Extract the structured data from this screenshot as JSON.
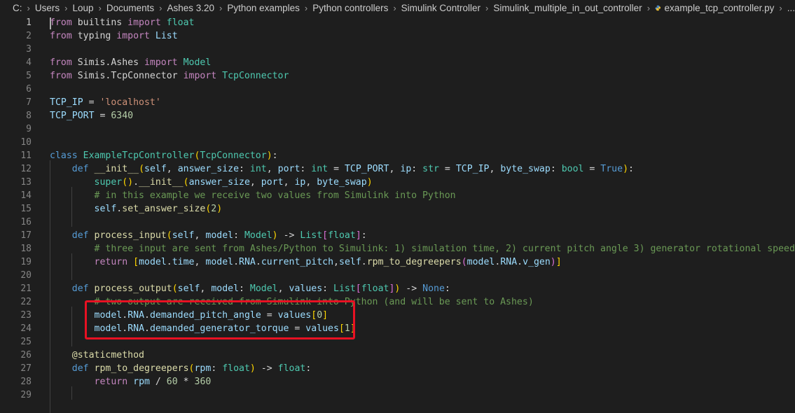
{
  "breadcrumb": {
    "items": [
      "C:",
      "Users",
      "Loup",
      "Documents",
      "Ashes 3.20",
      "Python examples",
      "Python controllers",
      "Simulink Controller",
      "Simulink_multiple_in_out_controller"
    ],
    "file_icon": "python-file-icon",
    "file": "example_tcp_controller.py",
    "more": "..."
  },
  "editor": {
    "active_line": 1,
    "highlight": {
      "label": "red-annotation-box",
      "lines": [
        23,
        24
      ],
      "color": "#e81123"
    },
    "lines": [
      {
        "n": "1",
        "t": [
          [
            "from",
            "kw"
          ],
          [
            " builtins ",
            "tx"
          ],
          [
            "import",
            "kw"
          ],
          [
            " float",
            "cls"
          ]
        ]
      },
      {
        "n": "2",
        "t": [
          [
            "from",
            "kw"
          ],
          [
            " typing ",
            "tx"
          ],
          [
            "import",
            "kw"
          ],
          [
            " List",
            "var"
          ]
        ]
      },
      {
        "n": "3",
        "t": []
      },
      {
        "n": "4",
        "t": [
          [
            "from",
            "kw"
          ],
          [
            " Simis.Ashes ",
            "tx"
          ],
          [
            "import",
            "kw"
          ],
          [
            " Model",
            "cls"
          ]
        ]
      },
      {
        "n": "5",
        "t": [
          [
            "from",
            "kw"
          ],
          [
            " Simis.TcpConnector ",
            "tx"
          ],
          [
            "import",
            "kw"
          ],
          [
            " TcpConnector",
            "cls"
          ]
        ]
      },
      {
        "n": "6",
        "t": []
      },
      {
        "n": "7",
        "t": [
          [
            "TCP_IP",
            "var"
          ],
          [
            " = ",
            "tx"
          ],
          [
            "'localhost'",
            "str"
          ]
        ]
      },
      {
        "n": "8",
        "t": [
          [
            "TCP_PORT",
            "var"
          ],
          [
            " = ",
            "tx"
          ],
          [
            "6340",
            "num"
          ]
        ]
      },
      {
        "n": "9",
        "t": []
      },
      {
        "n": "10",
        "t": []
      },
      {
        "n": "11",
        "t": [
          [
            "class",
            "st"
          ],
          [
            " ",
            "tx"
          ],
          [
            "ExampleTcpController",
            "cls"
          ],
          [
            "(",
            "br1"
          ],
          [
            "TcpConnector",
            "cls"
          ],
          [
            ")",
            "br1"
          ],
          [
            ":",
            "tx"
          ]
        ]
      },
      {
        "n": "12",
        "t": [
          [
            "    ",
            "tx"
          ],
          [
            "def",
            "st"
          ],
          [
            " ",
            "tx"
          ],
          [
            "__init__",
            "fn"
          ],
          [
            "(",
            "br1"
          ],
          [
            "self",
            "var"
          ],
          [
            ", ",
            "tx"
          ],
          [
            "answer_size",
            "var"
          ],
          [
            ": ",
            "tx"
          ],
          [
            "int",
            "cls"
          ],
          [
            ", ",
            "tx"
          ],
          [
            "port",
            "var"
          ],
          [
            ": ",
            "tx"
          ],
          [
            "int",
            "cls"
          ],
          [
            " = ",
            "tx"
          ],
          [
            "TCP_PORT",
            "var"
          ],
          [
            ", ",
            "tx"
          ],
          [
            "ip",
            "var"
          ],
          [
            ": ",
            "tx"
          ],
          [
            "str",
            "cls"
          ],
          [
            " = ",
            "tx"
          ],
          [
            "TCP_IP",
            "var"
          ],
          [
            ", ",
            "tx"
          ],
          [
            "byte_swap",
            "var"
          ],
          [
            ": ",
            "tx"
          ],
          [
            "bool",
            "cls"
          ],
          [
            " = ",
            "tx"
          ],
          [
            "True",
            "st"
          ],
          [
            ")",
            "br1"
          ],
          [
            ":",
            "tx"
          ]
        ]
      },
      {
        "n": "13",
        "t": [
          [
            "        ",
            "tx"
          ],
          [
            "super",
            "cls"
          ],
          [
            "()",
            "br1"
          ],
          [
            ".",
            "tx"
          ],
          [
            "__init__",
            "fn"
          ],
          [
            "(",
            "br1"
          ],
          [
            "answer_size",
            "var"
          ],
          [
            ", ",
            "tx"
          ],
          [
            "port",
            "var"
          ],
          [
            ", ",
            "tx"
          ],
          [
            "ip",
            "var"
          ],
          [
            ", ",
            "tx"
          ],
          [
            "byte_swap",
            "var"
          ],
          [
            ")",
            "br1"
          ]
        ]
      },
      {
        "n": "14",
        "t": [
          [
            "        ",
            "tx"
          ],
          [
            "# in this example we receive two values from Simulink into Python",
            "com"
          ]
        ]
      },
      {
        "n": "15",
        "t": [
          [
            "        ",
            "tx"
          ],
          [
            "self",
            "var"
          ],
          [
            ".",
            "tx"
          ],
          [
            "set_answer_size",
            "fn"
          ],
          [
            "(",
            "br1"
          ],
          [
            "2",
            "num"
          ],
          [
            ")",
            "br1"
          ]
        ]
      },
      {
        "n": "16",
        "t": []
      },
      {
        "n": "17",
        "t": [
          [
            "    ",
            "tx"
          ],
          [
            "def",
            "st"
          ],
          [
            " ",
            "tx"
          ],
          [
            "process_input",
            "fn"
          ],
          [
            "(",
            "br1"
          ],
          [
            "self",
            "var"
          ],
          [
            ", ",
            "tx"
          ],
          [
            "model",
            "var"
          ],
          [
            ": ",
            "tx"
          ],
          [
            "Model",
            "cls"
          ],
          [
            ")",
            "br1"
          ],
          [
            " -> ",
            "tx"
          ],
          [
            "List",
            "cls"
          ],
          [
            "[",
            "br2"
          ],
          [
            "float",
            "cls"
          ],
          [
            "]",
            "br2"
          ],
          [
            ":",
            "tx"
          ]
        ]
      },
      {
        "n": "18",
        "t": [
          [
            "        ",
            "tx"
          ],
          [
            "# three input are sent from Ashes/Python to Simulink: 1) simulation time, 2) current pitch angle 3) generator rotational speed",
            "com"
          ]
        ]
      },
      {
        "n": "19",
        "t": [
          [
            "        ",
            "tx"
          ],
          [
            "return",
            "kw"
          ],
          [
            " ",
            "tx"
          ],
          [
            "[",
            "br1"
          ],
          [
            "model",
            "var"
          ],
          [
            ".",
            "tx"
          ],
          [
            "time",
            "var"
          ],
          [
            ", ",
            "tx"
          ],
          [
            "model",
            "var"
          ],
          [
            ".",
            "tx"
          ],
          [
            "RNA",
            "var"
          ],
          [
            ".",
            "tx"
          ],
          [
            "current_pitch",
            "var"
          ],
          [
            ",",
            "tx"
          ],
          [
            "self",
            "var"
          ],
          [
            ".",
            "tx"
          ],
          [
            "rpm_to_degreepers",
            "fn"
          ],
          [
            "(",
            "br2"
          ],
          [
            "model",
            "var"
          ],
          [
            ".",
            "tx"
          ],
          [
            "RNA",
            "var"
          ],
          [
            ".",
            "tx"
          ],
          [
            "v_gen",
            "var"
          ],
          [
            ")",
            "br2"
          ],
          [
            "]",
            "br1"
          ]
        ]
      },
      {
        "n": "20",
        "t": []
      },
      {
        "n": "21",
        "t": [
          [
            "    ",
            "tx"
          ],
          [
            "def",
            "st"
          ],
          [
            " ",
            "tx"
          ],
          [
            "process_output",
            "fn"
          ],
          [
            "(",
            "br1"
          ],
          [
            "self",
            "var"
          ],
          [
            ", ",
            "tx"
          ],
          [
            "model",
            "var"
          ],
          [
            ": ",
            "tx"
          ],
          [
            "Model",
            "cls"
          ],
          [
            ", ",
            "tx"
          ],
          [
            "values",
            "var"
          ],
          [
            ": ",
            "tx"
          ],
          [
            "List",
            "cls"
          ],
          [
            "[",
            "br2"
          ],
          [
            "float",
            "cls"
          ],
          [
            "]",
            "br2"
          ],
          [
            ")",
            "br1"
          ],
          [
            " -> ",
            "tx"
          ],
          [
            "None",
            "st"
          ],
          [
            ":",
            "tx"
          ]
        ]
      },
      {
        "n": "22",
        "t": [
          [
            "        ",
            "tx"
          ],
          [
            "# two output are received from Simulink into Python (and will be sent to Ashes)",
            "com"
          ]
        ]
      },
      {
        "n": "23",
        "t": [
          [
            "        ",
            "tx"
          ],
          [
            "model",
            "var"
          ],
          [
            ".",
            "tx"
          ],
          [
            "RNA",
            "var"
          ],
          [
            ".",
            "tx"
          ],
          [
            "demanded_pitch_angle",
            "var"
          ],
          [
            " = ",
            "tx"
          ],
          [
            "values",
            "var"
          ],
          [
            "[",
            "br1"
          ],
          [
            "0",
            "num"
          ],
          [
            "]",
            "br1"
          ]
        ]
      },
      {
        "n": "24",
        "t": [
          [
            "        ",
            "tx"
          ],
          [
            "model",
            "var"
          ],
          [
            ".",
            "tx"
          ],
          [
            "RNA",
            "var"
          ],
          [
            ".",
            "tx"
          ],
          [
            "demanded_generator_torque",
            "var"
          ],
          [
            " = ",
            "tx"
          ],
          [
            "values",
            "var"
          ],
          [
            "[",
            "br1"
          ],
          [
            "1",
            "num"
          ],
          [
            "]",
            "br1"
          ]
        ]
      },
      {
        "n": "25",
        "t": []
      },
      {
        "n": "26",
        "t": [
          [
            "    ",
            "tx"
          ],
          [
            "@staticmethod",
            "dec"
          ]
        ]
      },
      {
        "n": "27",
        "t": [
          [
            "    ",
            "tx"
          ],
          [
            "def",
            "st"
          ],
          [
            " ",
            "tx"
          ],
          [
            "rpm_to_degreepers",
            "fn"
          ],
          [
            "(",
            "br1"
          ],
          [
            "rpm",
            "var"
          ],
          [
            ": ",
            "tx"
          ],
          [
            "float",
            "cls"
          ],
          [
            ")",
            "br1"
          ],
          [
            " -> ",
            "tx"
          ],
          [
            "float",
            "cls"
          ],
          [
            ":",
            "tx"
          ]
        ]
      },
      {
        "n": "28",
        "t": [
          [
            "        ",
            "tx"
          ],
          [
            "return",
            "kw"
          ],
          [
            " ",
            "tx"
          ],
          [
            "rpm",
            "var"
          ],
          [
            " / ",
            "tx"
          ],
          [
            "60",
            "num"
          ],
          [
            " * ",
            "tx"
          ],
          [
            "360",
            "num"
          ]
        ]
      },
      {
        "n": "29",
        "t": []
      }
    ]
  }
}
